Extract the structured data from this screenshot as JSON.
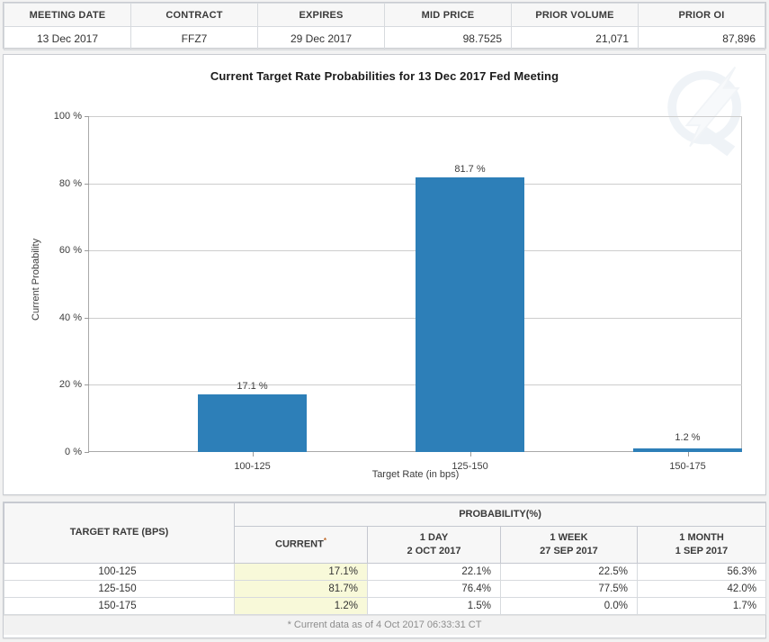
{
  "summary": {
    "headers": [
      "MEETING DATE",
      "CONTRACT",
      "EXPIRES",
      "MID PRICE",
      "PRIOR VOLUME",
      "PRIOR OI"
    ],
    "row": [
      "13 Dec 2017",
      "FFZ7",
      "29 Dec 2017",
      "98.7525",
      "21,071",
      "87,896"
    ]
  },
  "chart_data": {
    "type": "bar",
    "title": "Current Target Rate Probabilities for 13 Dec 2017 Fed Meeting",
    "xlabel": "Target Rate (in bps)",
    "ylabel": "Current Probability",
    "categories": [
      "100-125",
      "125-150",
      "150-175"
    ],
    "values": [
      17.1,
      81.7,
      1.2
    ],
    "value_labels": [
      "17.1 %",
      "81.7 %",
      "1.2 %"
    ],
    "ylim": [
      0,
      100
    ],
    "yticks": [
      0,
      20,
      40,
      60,
      80,
      100
    ],
    "ytick_labels": [
      "0 %",
      "20 %",
      "40 %",
      "60 %",
      "80 %",
      "100 %"
    ],
    "grid": true,
    "legend": "none",
    "bar_color": "#2d7fb8",
    "watermark": "quikstrike-logo-watermark"
  },
  "prob_table": {
    "group_header": "PROBABILITY(%)",
    "col_rate": "TARGET RATE (BPS)",
    "columns": [
      {
        "label": "CURRENT",
        "sublabel": "",
        "asterisk": "*"
      },
      {
        "label": "1 DAY",
        "sublabel": "2 OCT 2017",
        "asterisk": ""
      },
      {
        "label": "1 WEEK",
        "sublabel": "27 SEP 2017",
        "asterisk": ""
      },
      {
        "label": "1 MONTH",
        "sublabel": "1 SEP 2017",
        "asterisk": ""
      }
    ],
    "rows": [
      {
        "rate": "100-125",
        "current": "17.1%",
        "day1": "22.1%",
        "week1": "22.5%",
        "month1": "56.3%"
      },
      {
        "rate": "125-150",
        "current": "81.7%",
        "day1": "76.4%",
        "week1": "77.5%",
        "month1": "42.0%"
      },
      {
        "rate": "150-175",
        "current": "1.2%",
        "day1": "1.5%",
        "week1": "0.0%",
        "month1": "1.7%"
      }
    ],
    "footnote": "* Current data as of 4 Oct 2017 06:33:31 CT"
  },
  "colors": {
    "bar": "#2d7fb8",
    "current_highlight": "#f8f9d9",
    "header_bg": "#f7f7f7"
  }
}
